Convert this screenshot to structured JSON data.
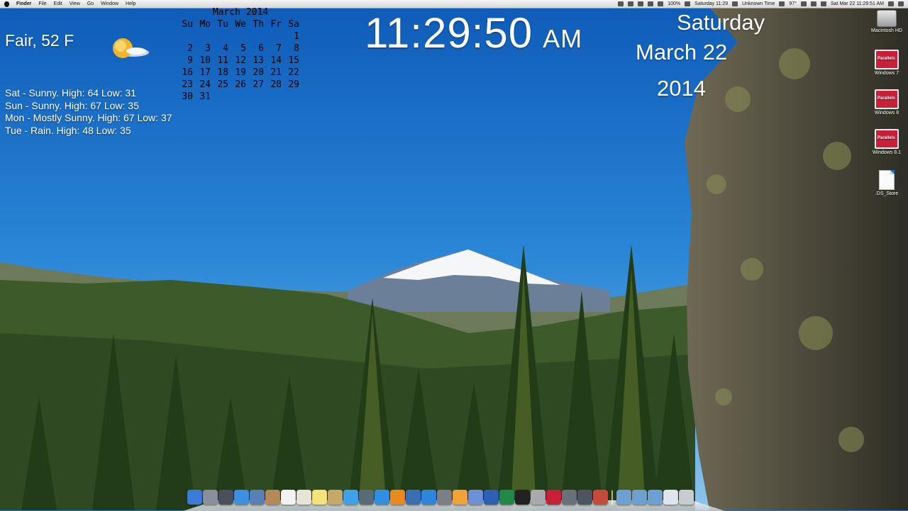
{
  "menubar": {
    "app_name": "Finder",
    "menus": [
      "File",
      "Edit",
      "View",
      "Go",
      "Window",
      "Help"
    ],
    "battery": "100%",
    "clock_short": "Saturday 11:29",
    "time_status": "Unknown Time",
    "temperature": "97°",
    "datetime": "Sat Mar 22  11:29:51 AM"
  },
  "weather": {
    "current": "Fair, 52 F",
    "icon": "partly-sunny-icon",
    "forecast": [
      "Sat - Sunny. High: 64 Low: 31",
      "Sun - Sunny. High: 67 Low: 35",
      "Mon - Mostly Sunny. High: 67 Low: 37",
      "Tue - Rain. High: 48 Low: 35"
    ]
  },
  "calendar": {
    "title": "March 2014",
    "weekdays": [
      "Su",
      "Mo",
      "Tu",
      "We",
      "Th",
      "Fr",
      "Sa"
    ],
    "weeks": [
      [
        "",
        "",
        "",
        "",
        "",
        "",
        "1"
      ],
      [
        "2",
        "3",
        "4",
        "5",
        "6",
        "7",
        "8"
      ],
      [
        "9",
        "10",
        "11",
        "12",
        "13",
        "14",
        "15"
      ],
      [
        "16",
        "17",
        "18",
        "19",
        "20",
        "21",
        "22"
      ],
      [
        "23",
        "24",
        "25",
        "26",
        "27",
        "28",
        "29"
      ],
      [
        "30",
        "31",
        "",
        "",
        "",
        "",
        ""
      ]
    ]
  },
  "clock": {
    "time": "11:29:50",
    "ampm": "AM",
    "day": "Saturday",
    "date": "March 22",
    "year": "2014"
  },
  "desktop_icons": [
    {
      "label": "Macintosh HD",
      "icon": "hard-drive-icon"
    },
    {
      "label": "Windows 7",
      "icon": "parallels-vm-icon"
    },
    {
      "label": "Windows 8",
      "icon": "parallels-vm-icon"
    },
    {
      "label": "Windows 8.1",
      "icon": "parallels-vm-icon"
    },
    {
      "label": ".DS_Store",
      "icon": "document-icon"
    }
  ],
  "parallels_badge": "Parallels",
  "dock": {
    "items": [
      {
        "icon": "finder-icon",
        "color": "#3b7bd6"
      },
      {
        "icon": "launchpad-icon",
        "color": "#8a8f99"
      },
      {
        "icon": "mission-control-icon",
        "color": "#4a4f5c"
      },
      {
        "icon": "safari-icon",
        "color": "#3d8fe0"
      },
      {
        "icon": "mail-stamp-icon",
        "color": "#5a7fb5"
      },
      {
        "icon": "contacts-icon",
        "color": "#b3895a"
      },
      {
        "icon": "calendar-icon",
        "color": "#f2f2f2"
      },
      {
        "icon": "text-edit-icon",
        "color": "#e6e3d8"
      },
      {
        "icon": "notes-icon",
        "color": "#f4e27a"
      },
      {
        "icon": "preview-icon",
        "color": "#c7a86a"
      },
      {
        "icon": "messages-icon",
        "color": "#3fa1e8"
      },
      {
        "icon": "facetime-icon",
        "color": "#5a6b78"
      },
      {
        "icon": "itunes-icon",
        "color": "#2f8fe2"
      },
      {
        "icon": "ibooks-icon",
        "color": "#e98a20"
      },
      {
        "icon": "quicktime-icon",
        "color": "#3a6fb5"
      },
      {
        "icon": "app-store-icon",
        "color": "#2d86de"
      },
      {
        "icon": "system-preferences-icon",
        "color": "#7c7f86"
      },
      {
        "icon": "pages-icon",
        "color": "#f1a33a"
      },
      {
        "icon": "keynote-icon",
        "color": "#6c8fd8"
      },
      {
        "icon": "word-icon",
        "color": "#2f5fb3"
      },
      {
        "icon": "excel-icon",
        "color": "#23874a"
      },
      {
        "icon": "terminal-icon",
        "color": "#222222"
      },
      {
        "icon": "disk-utility-icon",
        "color": "#a7a9ad"
      },
      {
        "icon": "parallels-icon",
        "color": "#c9203a"
      },
      {
        "icon": "grapher-icon",
        "color": "#6b6f78"
      },
      {
        "icon": "image-capture-icon",
        "color": "#4d5561"
      },
      {
        "icon": "photo-booth-icon",
        "color": "#c44a3a"
      }
    ],
    "folders": [
      {
        "icon": "applications-folder-icon",
        "color": "#6d9fd3"
      },
      {
        "icon": "documents-folder-icon",
        "color": "#6d9fd3"
      },
      {
        "icon": "downloads-folder-icon",
        "color": "#6d9fd3"
      },
      {
        "icon": "stack-icon",
        "color": "#dfe5ee"
      },
      {
        "icon": "trash-icon",
        "color": "#c8ccd2"
      }
    ]
  }
}
